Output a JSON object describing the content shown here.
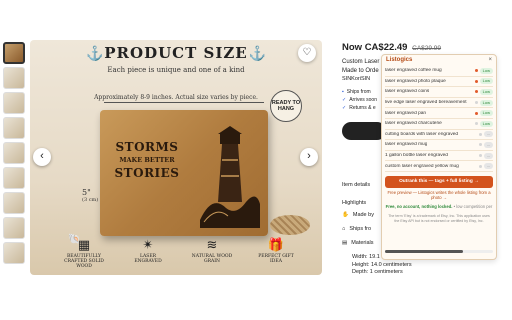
{
  "listing": {
    "price": "Now CA$22.49",
    "old_price": "CA$29.99",
    "title_line1": "Custom Laser",
    "title_line2": "Made to Orde",
    "shop": "SINKoriSIN",
    "bullets": [
      "Ships from",
      "Arrives soon",
      "Returns & e"
    ],
    "item_details": "Item details",
    "highlights": "Highlights",
    "highlight_rows": [
      "Made by",
      "Ships fro",
      "Materials"
    ],
    "dims": [
      "Width: 19.1 centimeters",
      "Height: 14.0 centimeters",
      "Depth: 1 centimeters"
    ]
  },
  "hero": {
    "title": "PRODUCT SIZE",
    "subtitle": "Each piece is unique and one of a kind",
    "note": "Approximately 8-9 inches. Actual size varies by piece.",
    "plaque_line1": "STORMS",
    "plaque_line2": "MAKE BETTER",
    "plaque_line3": "STORIES",
    "badge": "READY TO HANG",
    "dim_left": "5\"",
    "dim_left_cm": "(3 cm)",
    "features": [
      {
        "icon": "▦",
        "label": "BEAUTIFULLY CRAFTED SOLID WOOD"
      },
      {
        "icon": "✴",
        "label": "LASER ENGRAVED"
      },
      {
        "icon": "≋",
        "label": "NATURAL WOOD GRAIN"
      },
      {
        "icon": "🎁",
        "label": "PERFECT GIFT IDEA"
      }
    ]
  },
  "extension": {
    "name": "Listogics",
    "close": "×",
    "rows": [
      {
        "label": "laser engraved coffee mug",
        "status": "Low"
      },
      {
        "label": "laser engraved photo plaque",
        "status": "Low"
      },
      {
        "label": "laser engraved coins",
        "status": "Low"
      },
      {
        "label": "live edge laser engraved bereavement",
        "status": "Low"
      },
      {
        "label": "laser engraved pan",
        "status": "Low"
      },
      {
        "label": "laser engraved charcuterie",
        "status": "Low"
      },
      {
        "label": "cutting boards with laser engraved",
        "status": "..."
      },
      {
        "label": "laser engraved mug",
        "status": "..."
      },
      {
        "label": "1 gallon bottle laser engraved",
        "status": "..."
      },
      {
        "label": "custom laser engraved yellow mug",
        "status": "..."
      }
    ],
    "outrank_label": "Outrank this — tags + full listing →",
    "note": "Free preview — Listogics writes the whole listing from a photo →",
    "free_text": "Free, no account, nothing locked.",
    "free_suffix": "• low competition per",
    "disclaimer": "The term 'Etsy' is a trademark of Etsy, Inc. This application uses the Etsy API but is not endorsed or certified by Etsy, Inc.",
    "scroll_fraction": 0.72
  }
}
